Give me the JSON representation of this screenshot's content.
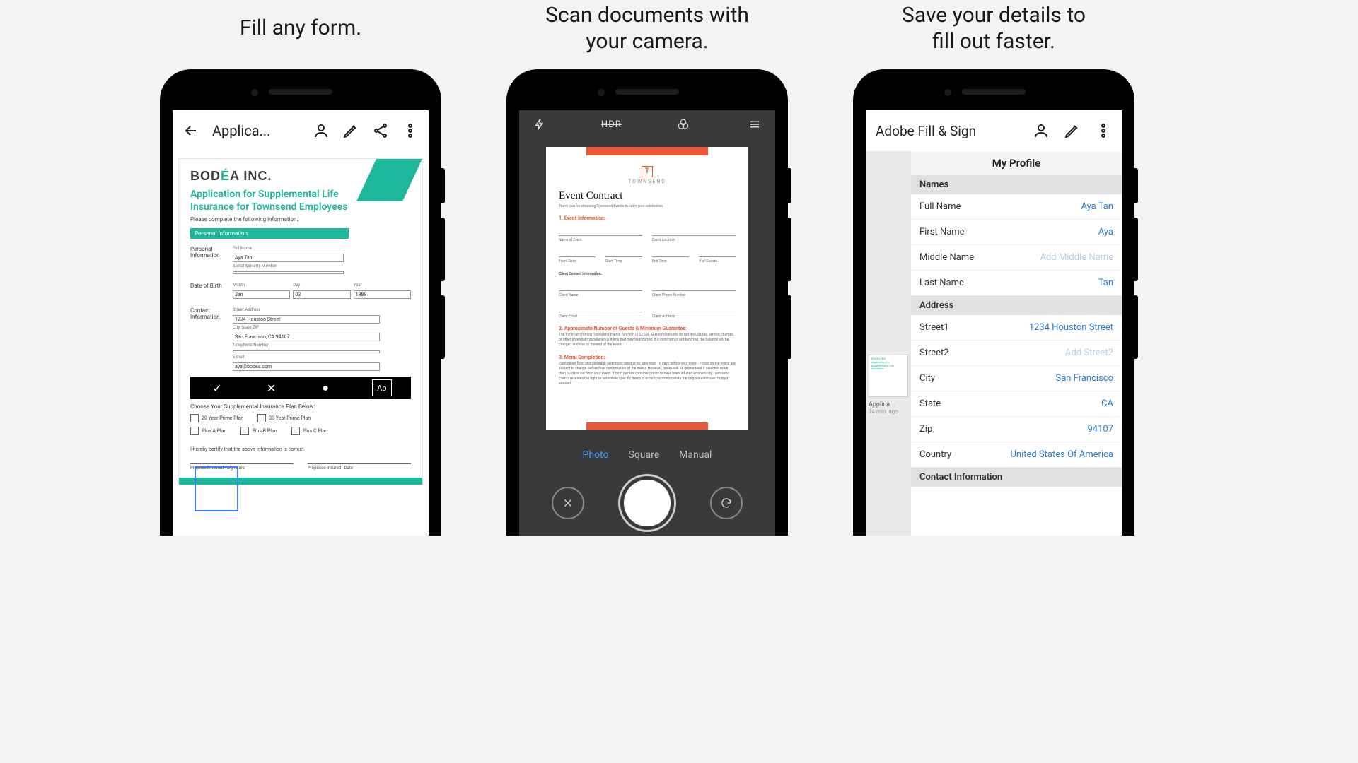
{
  "panel1": {
    "caption": "Fill any form.",
    "toolbar": {
      "title": "Applica..."
    },
    "doc": {
      "brand_pre": "BOD",
      "brand_accent": "É",
      "brand_post": "A INC.",
      "title_l1": "Application for Supplemental Life",
      "title_l2": "Insurance for Townsend Employees",
      "sub": "Please complete the following information.",
      "sec_personal": "Personal Information",
      "lab_pi": "Personal Information",
      "lab_dob": "Date of Birth",
      "lab_ci": "Contact Information",
      "full_name_lab": "Full Name",
      "full_name_val": "Aya Tan",
      "ssn_lab": "Social Security Number",
      "month_lab": "Month",
      "month_val": "Jan",
      "day_lab": "Day",
      "day_val": "03",
      "year_lab": "Year",
      "year_val": "1989",
      "street_lab": "Street Address",
      "street_val": "1234 Houston Street",
      "csz_lab": "City, State ZIP",
      "csz_val": "San Francisco, CA 94107",
      "tel_lab": "Telephone Number",
      "email_lab": "E-mail",
      "email_val": "aya@bodea.com",
      "plan_hdr": "Choose Your Supplemental Insurance Plan Below:",
      "plan_a_20": "20 Year Prime Plan",
      "plan_a_30": "30 Year Prime Plan",
      "plus_a": "Plus A Plan",
      "plus_b": "Plus B Plan",
      "plus_c": "Plus C Plan",
      "cert": "I hereby certify that the above information is correct.",
      "sig1": "Proposed Insured - Signature",
      "sig2": "Proposed Insured - Date",
      "strip_ab": "Ab"
    }
  },
  "panel2": {
    "caption_l1": "Scan documents with",
    "caption_l2": "your camera.",
    "hdr": "HDR",
    "modes": {
      "photo": "Photo",
      "square": "Square",
      "manual": "Manual"
    },
    "doc": {
      "logo": "T",
      "logo_txt": "TOWNSEND",
      "title": "Event Contract",
      "thanks": "Thank you for choosing Townsend Events to cater your celebration.",
      "sec1": "1. Event Information:",
      "f_name": "Name of Event",
      "f_loc": "Event Location",
      "f_date": "Event Date",
      "f_start": "Start Time",
      "f_end": "End Time",
      "f_guests": "# of Guests",
      "cci": "Client Contact Information:",
      "c_name": "Client Name",
      "c_phone": "Client Phone Number",
      "c_email": "Client Email",
      "c_addr": "Client Address",
      "sec2": "2. Approximate Number of Guests & Minimum Guarantee:",
      "p2": "The minimum for any Townsend Events function is $2,500. Guest minimums do not include tax, service charges, or other potential miscellaneous items that may be incurred. If a minimum is not incurred, the balance will be charged and due by the end of the event.",
      "sec3": "3. Menu Completion:",
      "p3": "Completed food and beverage selections are due no later than 10 days before your event. Prices on the menu are subject to change before final confirmation of the menu. However, prices will be guaranteed if selected more than 30 days out from your event. If both parties consider prices to have been inflated erroneously, Townsend Events reserves the right to substitute specific items in order to accommodate the original estimated budget amount."
    }
  },
  "panel3": {
    "caption_l1": "Save your details to",
    "caption_l2": "fill out faster.",
    "title": "Adobe Fill & Sign",
    "profile_head": "My Profile",
    "sec_names": "Names",
    "sec_address": "Address",
    "sec_contact": "Contact Information",
    "thumb_lab": "Applica...",
    "thumb_sub": "14 min. ago",
    "rows": {
      "full_name_k": "Full Name",
      "full_name_v": "Aya Tan",
      "first_k": "First Name",
      "first_v": "Aya",
      "middle_k": "Middle Name",
      "middle_v": "Add Middle Name",
      "last_k": "Last Name",
      "last_v": "Tan",
      "street1_k": "Street1",
      "street1_v": "1234 Houston Street",
      "street2_k": "Street2",
      "street2_v": "Add Street2",
      "city_k": "City",
      "city_v": "San Francisco",
      "state_k": "State",
      "state_v": "CA",
      "zip_k": "Zip",
      "zip_v": "94107",
      "country_k": "Country",
      "country_v": "United States Of America"
    }
  }
}
